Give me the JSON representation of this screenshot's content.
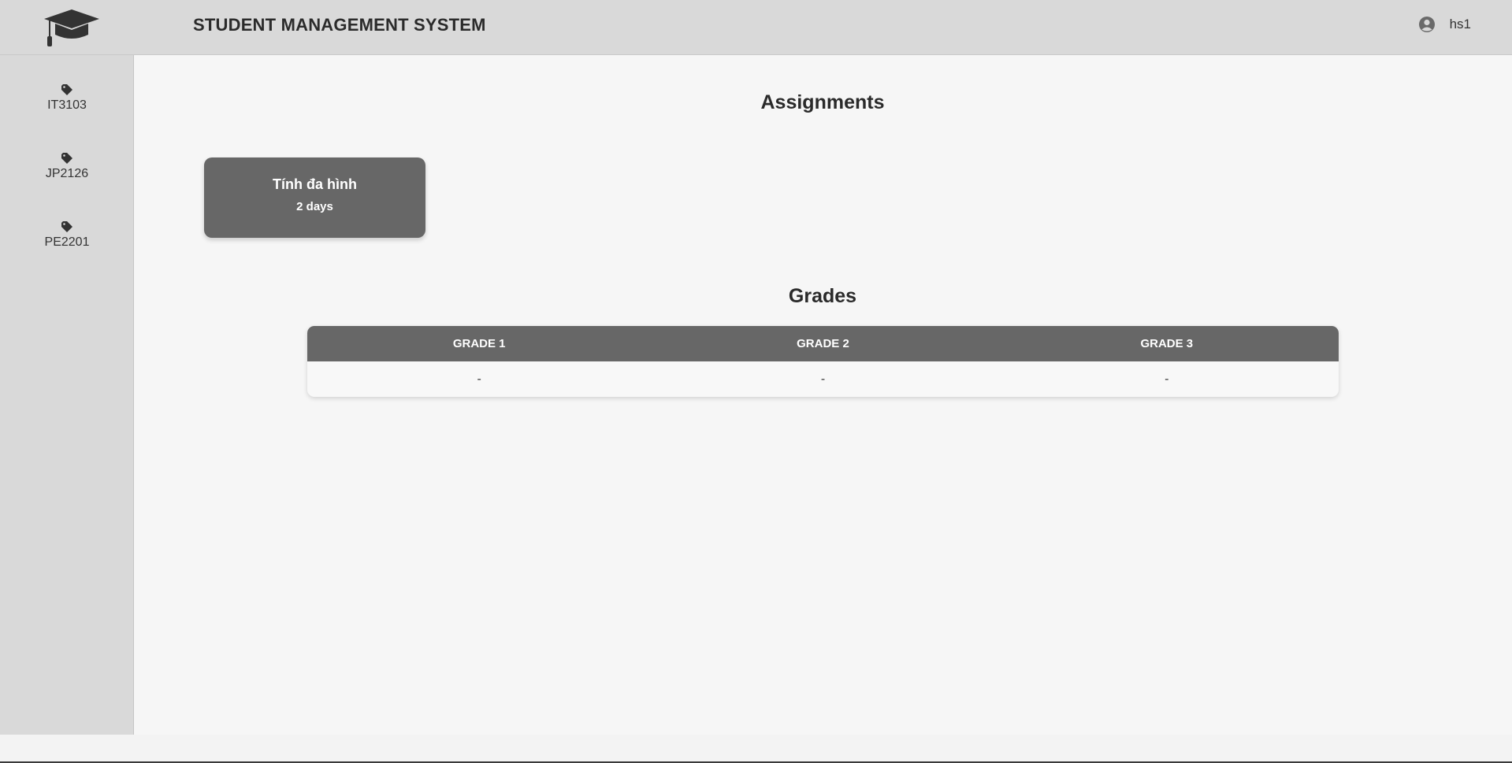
{
  "header": {
    "title": "STUDENT MANAGEMENT SYSTEM",
    "logo_icon": "graduation-cap-icon",
    "user": {
      "icon": "user-circle-icon",
      "name": "hs1"
    }
  },
  "sidebar": {
    "items": [
      {
        "label": "IT3103",
        "icon": "tag-icon"
      },
      {
        "label": "JP2126",
        "icon": "tag-icon"
      },
      {
        "label": "PE2201",
        "icon": "tag-icon"
      }
    ]
  },
  "assignments": {
    "title": "Assignments",
    "items": [
      {
        "name": "Tính đa hình",
        "due": "2 days"
      }
    ]
  },
  "grades": {
    "title": "Grades",
    "columns": [
      "GRADE 1",
      "GRADE 2",
      "GRADE 3"
    ],
    "rows": [
      [
        "-",
        "-",
        "-"
      ]
    ]
  },
  "colors": {
    "header_bg": "#d9d9d9",
    "page_bg": "#f6f6f6",
    "card_bg": "#676767",
    "text": "#2b2b2b"
  }
}
